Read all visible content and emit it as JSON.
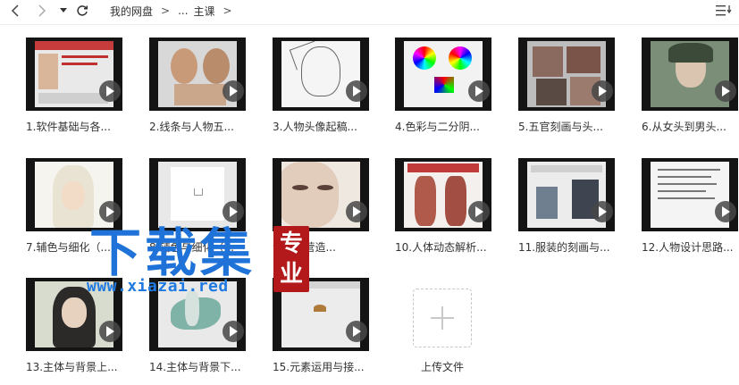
{
  "toolbar": {
    "back_icon": "chevron-left-icon",
    "forward_icon": "chevron-right-icon",
    "dropdown_icon": "caret-down-icon",
    "refresh_icon": "refresh-icon",
    "view_icon": "list-view-icon"
  },
  "breadcrumb": [
    {
      "label": "我的网盘"
    },
    {
      "label": "..."
    },
    {
      "label": "主课"
    }
  ],
  "breadcrumb_separator": ">",
  "files": [
    {
      "title": "1.软件基础与各...",
      "theme": "ui"
    },
    {
      "title": "2.线条与人物五...",
      "theme": "faces"
    },
    {
      "title": "3.人物头像起稿...",
      "theme": "sketch"
    },
    {
      "title": "4.色彩与二分阴...",
      "theme": "color"
    },
    {
      "title": "5.五官刻画与头...",
      "theme": "portrait"
    },
    {
      "title": "6.从女头到男头...",
      "theme": "portrait2"
    },
    {
      "title": "7.辅色与细化（...",
      "theme": "whitehair"
    },
    {
      "title": "8.辅色与细化（...",
      "theme": "blank"
    },
    {
      "title": "9.氛围营造...",
      "theme": "closeup"
    },
    {
      "title": "10.人体动态解析...",
      "theme": "anatomy"
    },
    {
      "title": "11.服装的刻画与...",
      "theme": "clothing"
    },
    {
      "title": "12.人物设计思路...",
      "theme": "doc"
    },
    {
      "title": "13.主体与背景上...",
      "theme": "man"
    },
    {
      "title": "14.主体与背景下...",
      "theme": "dragon"
    },
    {
      "title": "15.元素运用与接...",
      "theme": "element"
    }
  ],
  "upload": {
    "label": "上传文件",
    "icon": "plus-icon"
  },
  "watermark": {
    "text": "下载集",
    "seal": [
      "专",
      "业"
    ],
    "url": "www.xiazai.red"
  },
  "colors": {
    "thumb_bg": "#141414",
    "watermark_blue": "#1f73d8",
    "seal_red": "#b3181a"
  }
}
